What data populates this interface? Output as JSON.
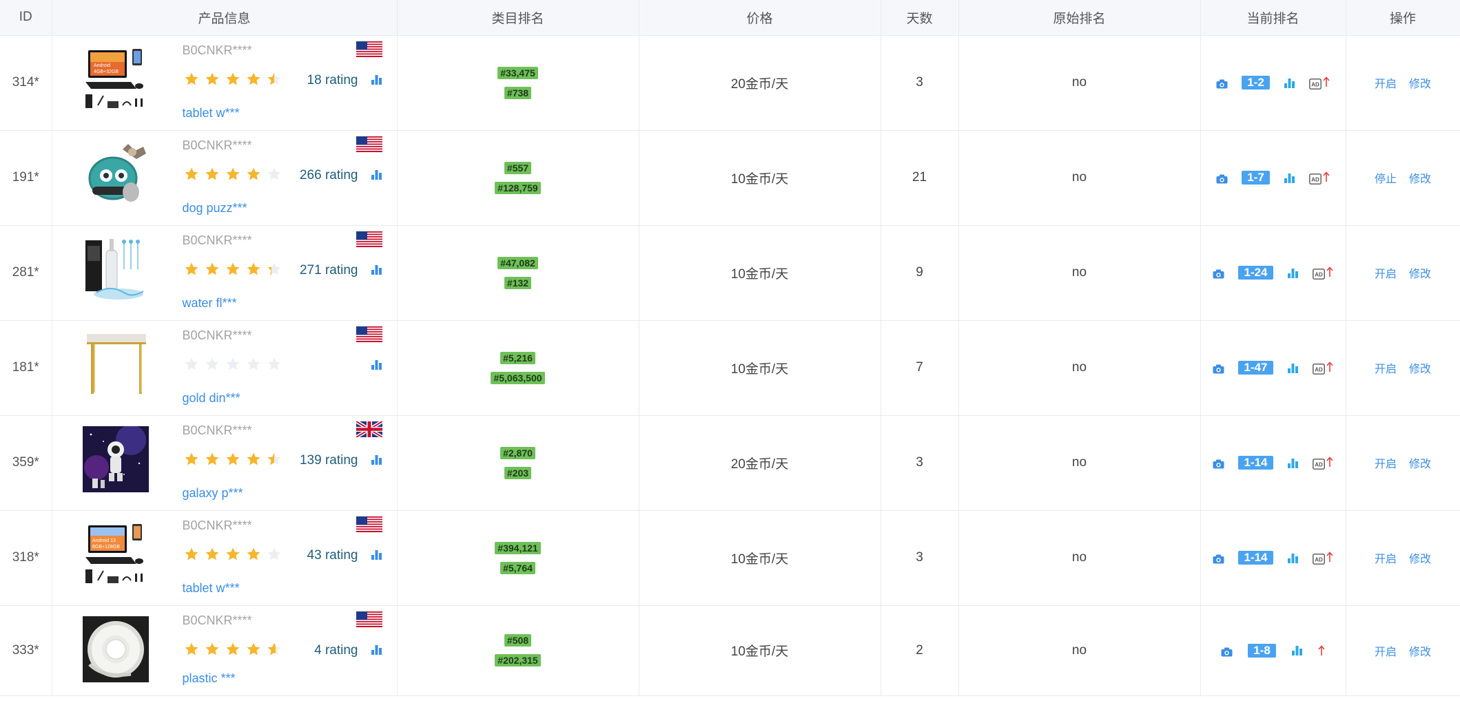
{
  "colors": {
    "accent": "#3a8ee6",
    "rank_bg": "#6fc05a",
    "badge_bg": "#4aa3f0",
    "star": "#f7b52b",
    "arrow": "#e83e3e"
  },
  "headers": {
    "id": "ID",
    "product": "产品信息",
    "category_rank": "类目排名",
    "price": "价格",
    "days": "天数",
    "original_rank": "原始排名",
    "current_rank": "当前排名",
    "actions": "操作"
  },
  "rows": [
    {
      "id": "314*",
      "asin": "B0CNKR****",
      "flag": "us",
      "stars": 4.5,
      "rating": "18 rating",
      "name": "tablet w***",
      "ranks": [
        "#33,475",
        "#738"
      ],
      "price": "20金币/天",
      "days": "3",
      "original": "no",
      "current": "1-2",
      "has_ad": true,
      "op_toggle": "开启",
      "op_edit": "修改"
    },
    {
      "id": "191*",
      "asin": "B0CNKR****",
      "flag": "us",
      "stars": 4,
      "rating": "266 rating",
      "name": "dog puzz***",
      "ranks": [
        "#557",
        "#128,759"
      ],
      "price": "10金币/天",
      "days": "21",
      "original": "no",
      "current": "1-7",
      "has_ad": true,
      "op_toggle": "停止",
      "op_edit": "修改"
    },
    {
      "id": "281*",
      "asin": "B0CNKR****",
      "flag": "us",
      "stars": 4.3,
      "rating": "271 rating",
      "name": "water fl***",
      "ranks": [
        "#47,082",
        "#132"
      ],
      "price": "10金币/天",
      "days": "9",
      "original": "no",
      "current": "1-24",
      "has_ad": true,
      "op_toggle": "开启",
      "op_edit": "修改"
    },
    {
      "id": "181*",
      "asin": "B0CNKR****",
      "flag": "us",
      "stars": 0,
      "rating": "",
      "name": "gold din***",
      "ranks": [
        "#5,216",
        "#5,063,500"
      ],
      "price": "10金币/天",
      "days": "7",
      "original": "no",
      "current": "1-47",
      "has_ad": true,
      "op_toggle": "开启",
      "op_edit": "修改"
    },
    {
      "id": "359*",
      "asin": "B0CNKR****",
      "flag": "uk",
      "stars": 4.5,
      "rating": "139 rating",
      "name": "galaxy p***",
      "ranks": [
        "#2,870",
        "#203"
      ],
      "price": "20金币/天",
      "days": "3",
      "original": "no",
      "current": "1-14",
      "has_ad": true,
      "op_toggle": "开启",
      "op_edit": "修改"
    },
    {
      "id": "318*",
      "asin": "B0CNKR****",
      "flag": "us",
      "stars": 4,
      "rating": "43 rating",
      "name": "tablet w***",
      "ranks": [
        "#394,121",
        "#5,764"
      ],
      "price": "10金币/天",
      "days": "3",
      "original": "no",
      "current": "1-14",
      "has_ad": true,
      "op_toggle": "开启",
      "op_edit": "修改"
    },
    {
      "id": "333*",
      "asin": "B0CNKR****",
      "flag": "us",
      "stars": 4.6,
      "rating": "4 rating",
      "name": "plastic ***",
      "ranks": [
        "#508",
        "#202,315"
      ],
      "price": "10金币/天",
      "days": "2",
      "original": "no",
      "current": "1-8",
      "has_ad": false,
      "op_toggle": "开启",
      "op_edit": "修改"
    }
  ]
}
